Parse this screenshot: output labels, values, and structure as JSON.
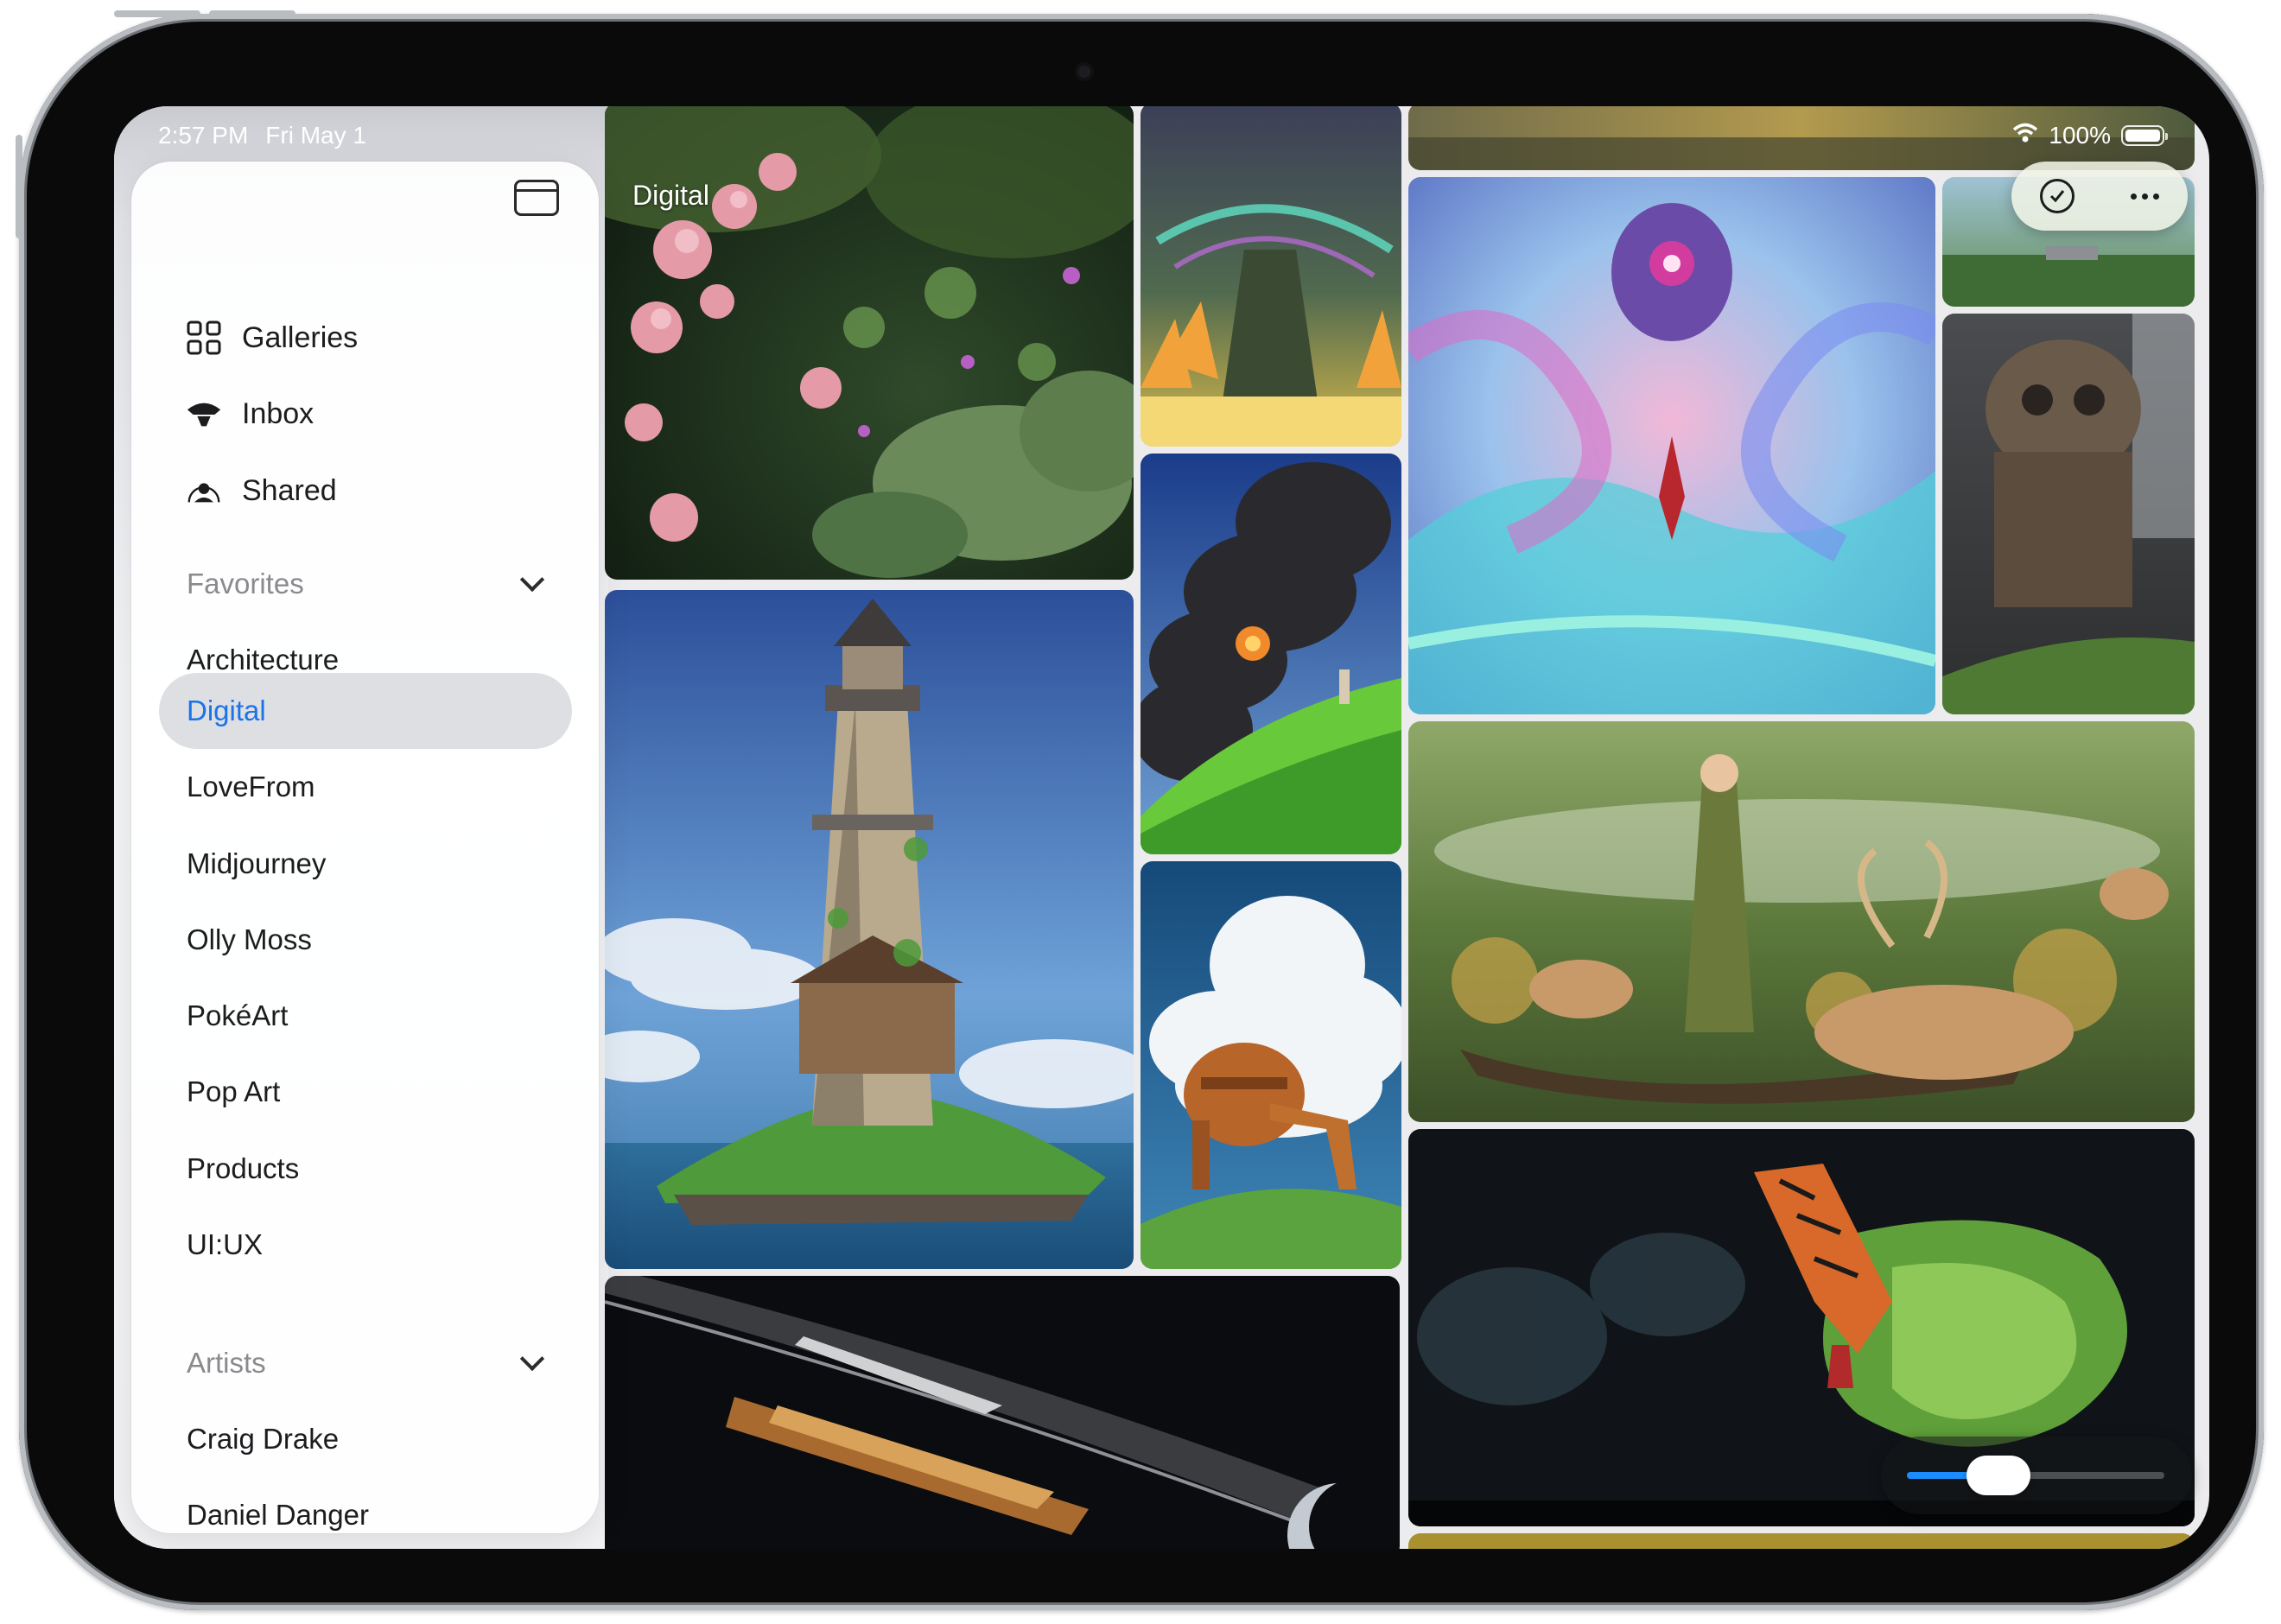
{
  "status_bar": {
    "time": "2:57 PM",
    "date": "Fri May 1",
    "battery": "100%",
    "wifi_icon": "wifi-icon",
    "battery_icon": "battery-icon"
  },
  "sidebar": {
    "toggle_icon": "sidebar-toggle-icon",
    "main_items": [
      {
        "label": "Galleries",
        "icon": "grid-icon"
      },
      {
        "label": "Inbox",
        "icon": "inbox-tray-icon"
      },
      {
        "label": "Shared",
        "icon": "person-circle-icon"
      }
    ],
    "favorites": {
      "header": "Favorites",
      "items": [
        "Architecture",
        "Digital",
        "LoveFrom",
        "Midjourney",
        "Olly Moss",
        "PokéArt",
        "Pop Art",
        "Products",
        "UI:UX"
      ],
      "selected": "Digital"
    },
    "artists": {
      "header": "Artists",
      "items": [
        "Craig Drake",
        "Daniel Danger"
      ]
    }
  },
  "gallery": {
    "title": "Digital",
    "select_icon": "checkmark-circle-icon",
    "more_icon": "ellipsis-icon",
    "zoom_level": 0.3
  },
  "colors": {
    "accent": "#1a73e8",
    "selected_bg": "#dedfe3"
  }
}
